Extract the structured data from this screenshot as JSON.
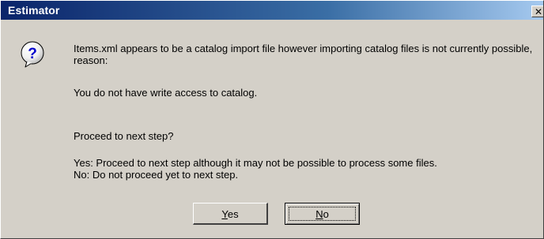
{
  "window": {
    "title": "Estimator"
  },
  "icons": {
    "close": "close-icon",
    "message": "question-icon"
  },
  "message": {
    "line1": "Items.xml appears to be a catalog import file however importing catalog files is not currently possible, reason:",
    "line2": "You do not have write access to catalog.",
    "line3": "Proceed to next step?",
    "line4": "Yes: Proceed to next step although it may not be possible to process some files.",
    "line5": "No: Do not proceed yet to next step."
  },
  "buttons": {
    "yes_accel": "Y",
    "yes_rest": "es",
    "no_accel": "N",
    "no_rest": "o"
  },
  "colors": {
    "face": "#d4d0c8",
    "titlebar_start": "#0a246a",
    "titlebar_end": "#a6caf0",
    "icon_blue": "#0000cc"
  }
}
